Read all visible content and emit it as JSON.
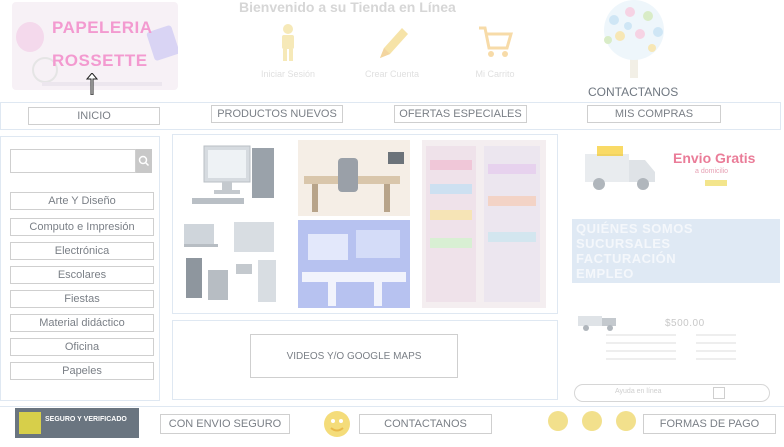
{
  "header": {
    "welcome": "Bienvenido a su Tienda en Línea",
    "logo": {
      "line1": "PAPELERIA",
      "line2": "ROSSETTE"
    },
    "links": [
      {
        "label": "Iniciar Sesión",
        "icon": "person-icon"
      },
      {
        "label": "Crear Cuenta",
        "icon": "pencil-icon"
      },
      {
        "label": "Mi Carrito",
        "icon": "cart-icon"
      }
    ],
    "contact_label": "CONTACTANOS"
  },
  "nav": {
    "items": [
      "INICIO",
      "PRODUCTOS NUEVOS",
      "OFERTAS ESPECIALES",
      "MIS COMPRAS"
    ]
  },
  "sidebar": {
    "search_placeholder": "",
    "categories": [
      "Arte Y Diseño",
      "Computo e Impresión",
      "Electrónica",
      "Escolares",
      "Fiestas",
      "Material didáctico",
      "Oficina",
      "Papeles"
    ]
  },
  "main": {
    "video_label": "VIDEOS Y/O GOOGLE MAPS"
  },
  "right": {
    "envio_title": "Envio Gratis",
    "envio_sub": "a domicilio",
    "info_links": [
      "QUIÉNES SOMOS",
      "SUCURSALES",
      "FACTURACIÓN",
      "EMPLEO"
    ],
    "price": "$500.00",
    "help": "Ayuda en línea"
  },
  "footer": {
    "seal_text": [
      "SEGURO Y VERIFICADO"
    ],
    "envio_seguro": "CON ENVIO SEGURO",
    "contact": "CONTACTANOS",
    "pago": "FORMAS DE PAGO"
  },
  "colors": {
    "logo_pink": "#f39ad0",
    "border": "#cfcfcf",
    "panel_border": "#dfe8f2",
    "envio_red": "#e84a6f",
    "envio_yellow": "#f5c200"
  }
}
